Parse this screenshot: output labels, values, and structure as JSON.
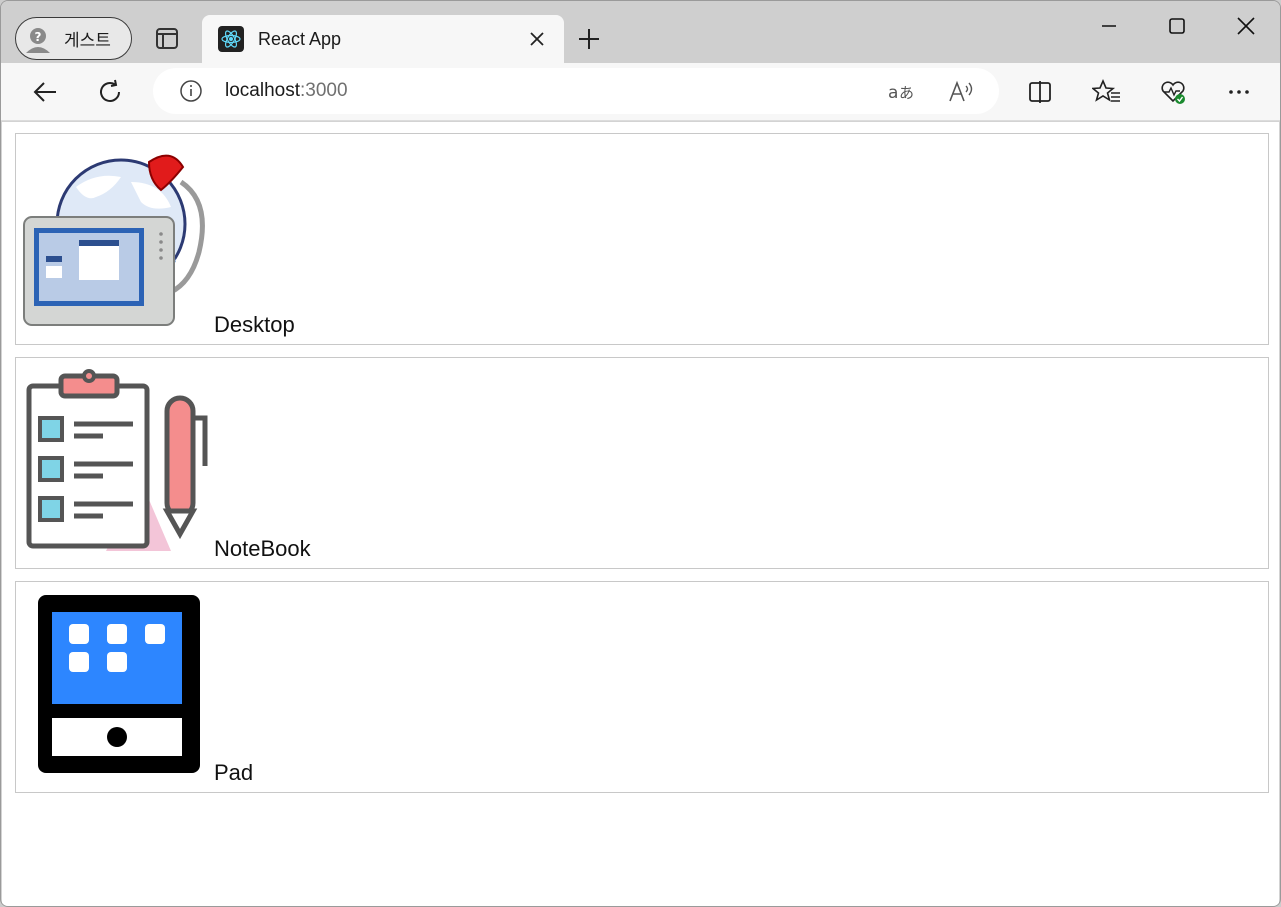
{
  "browser": {
    "profile_label": "게스트",
    "tab_title": "React App",
    "url_host": "localhost",
    "url_port": ":3000"
  },
  "icons": {
    "tab_actions": "tab-actions-icon",
    "favicon": "react-logo-icon",
    "tab_close": "close-icon",
    "new_tab": "plus-icon",
    "minimize": "minimize-icon",
    "maximize": "maximize-icon",
    "window_close": "close-icon",
    "back": "back-arrow-icon",
    "refresh": "refresh-icon",
    "site_info": "info-icon",
    "translate": "translate-icon",
    "read_aloud": "read-aloud-icon",
    "split_screen": "split-screen-icon",
    "favorites": "favorites-icon",
    "browser_essentials": "heart-pulse-icon",
    "more": "more-icon"
  },
  "devices": [
    {
      "label": "Desktop"
    },
    {
      "label": "NoteBook"
    },
    {
      "label": "Pad"
    }
  ],
  "colors": {
    "tabstrip": "#cfcfcf",
    "toolbar": "#f7f7f7",
    "pad_screen": "#2d86ff",
    "clipboard_accent": "#f48d8d",
    "checkbox": "#7fd4e6"
  }
}
